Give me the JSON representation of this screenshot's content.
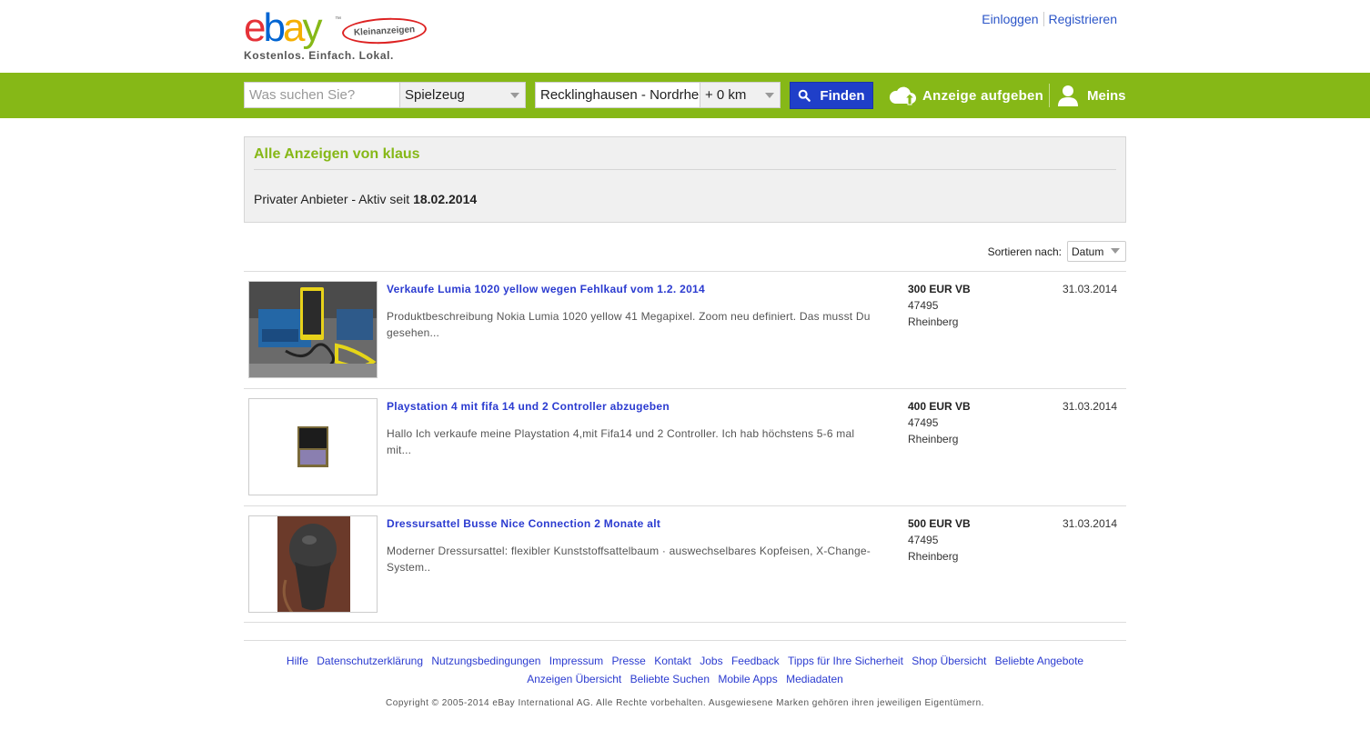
{
  "header": {
    "logo_text": [
      "e",
      "b",
      "a",
      "y"
    ],
    "logo_tm": "™",
    "logo_badge": "Kleinanzeigen",
    "slogan": "Kostenlos. Einfach. Lokal.",
    "login_label": "Einloggen",
    "register_label": "Registrieren"
  },
  "searchbar": {
    "search_placeholder": "Was suchen Sie?",
    "category_value": "Spielzeug",
    "location_value": "Recklinghausen - Nordrhei",
    "radius_value": "+ 0 km",
    "find_label": "Finden",
    "post_ad_label": "Anzeige aufgeben",
    "account_label": "Meins"
  },
  "profile": {
    "title": "Alle Anzeigen von klaus",
    "info_prefix": "Privater Anbieter - Aktiv seit ",
    "active_since": "18.02.2014"
  },
  "sort": {
    "label": "Sortieren nach:",
    "value": "Datum"
  },
  "listings": [
    {
      "title": "Verkaufe Lumia 1020 yellow wegen Fehlkauf vom 1.2. 2014",
      "description": "Produktbeschreibung Nokia Lumia 1020 yellow  41 Megapixel. Zoom neu definiert. Das musst Du gesehen...",
      "price": "300 EUR VB",
      "zip": "47495",
      "city": "Rheinberg",
      "date": "31.03.2014"
    },
    {
      "title": "Playstation 4 mit fifa 14 und 2 Controller abzugeben",
      "description": "Hallo Ich verkaufe meine Playstation 4,mit Fifa14 und 2 Controller. Ich hab höchstens 5-6 mal mit...",
      "price": "400 EUR VB",
      "zip": "47495",
      "city": "Rheinberg",
      "date": "31.03.2014"
    },
    {
      "title": "Dressursattel Busse Nice Connection 2 Monate alt",
      "description": "Moderner Dressursattel: flexibler Kunststoffsattelbaum · auswechselbares Kopfeisen, X-Change-System..",
      "price": "500 EUR VB",
      "zip": "47495",
      "city": "Rheinberg",
      "date": "31.03.2014"
    }
  ],
  "footer": {
    "links": [
      "Hilfe",
      "Datenschutzerklärung",
      "Nutzungsbedingungen",
      "Impressum",
      "Presse",
      "Kontakt",
      "Jobs",
      "Feedback",
      "Tipps für Ihre Sicherheit",
      "Shop Übersicht",
      "Beliebte Angebote",
      "Anzeigen Übersicht",
      "Beliebte Suchen",
      "Mobile Apps",
      "Mediadaten"
    ],
    "copyright": "Copyright © 2005-2014 eBay International AG. Alle Rechte vorbehalten. Ausgewiesene Marken gehören ihren jeweiligen Eigentümern."
  },
  "colors": {
    "brand_green": "#86b817",
    "button_blue": "#1f3fc9",
    "link_blue": "#2b3bd0"
  },
  "icons": {
    "search": "magnifier-icon",
    "post_ad": "cloud-upload-icon",
    "account": "user-icon"
  }
}
